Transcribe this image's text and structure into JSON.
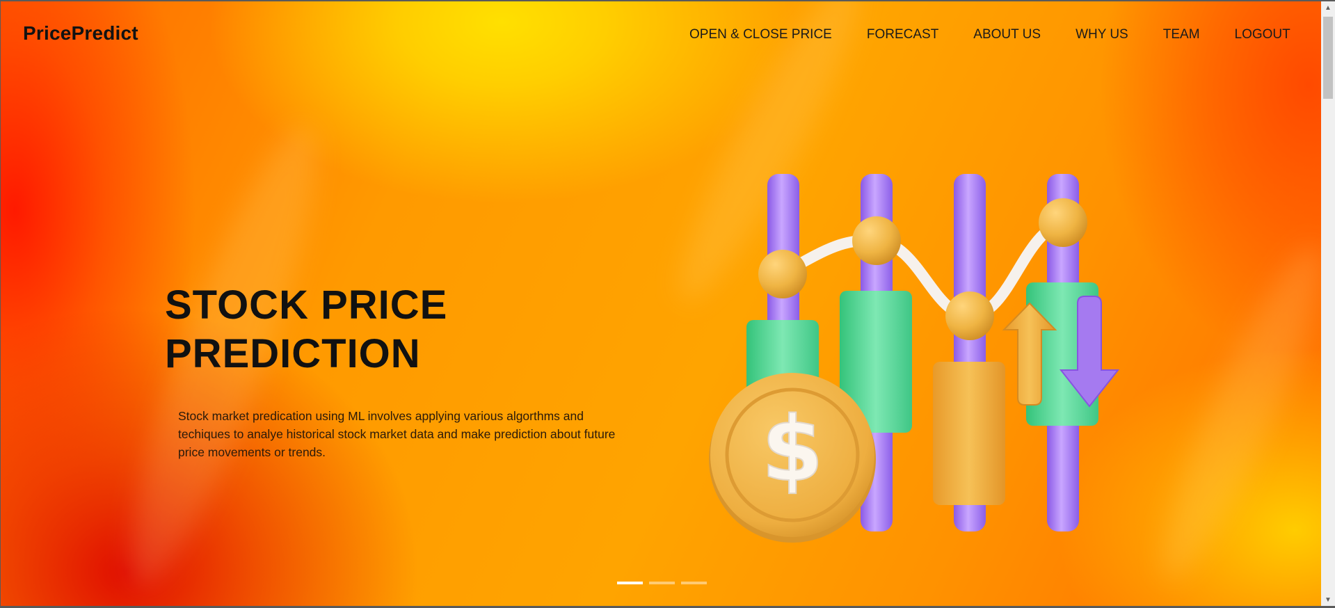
{
  "header": {
    "brand": "PricePredict",
    "nav": [
      {
        "label": "OPEN & CLOSE PRICE"
      },
      {
        "label": "FORECAST"
      },
      {
        "label": "ABOUT US"
      },
      {
        "label": "WHY US"
      },
      {
        "label": "TEAM"
      },
      {
        "label": "LOGOUT"
      }
    ]
  },
  "hero": {
    "title_line1": "STOCK PRICE",
    "title_line2": "PREDICTION",
    "description": "Stock market predication using ML involves applying various algorthms and techiques to analye historical stock market data and make prediction about future price movements or trends.",
    "illustration": "stock-candlestick-chart-with-dollar-coin",
    "currency_symbol": "$"
  },
  "carousel": {
    "slide_count": 3,
    "active_index": 0
  },
  "colors": {
    "brand_text": "#121212",
    "background_orange": "#ff9a00",
    "background_red": "#e00e00",
    "background_yellow": "#ffe000",
    "candle_purple": "#a57af0",
    "candle_green": "#4fd98f",
    "coin_gold": "#efb443"
  }
}
